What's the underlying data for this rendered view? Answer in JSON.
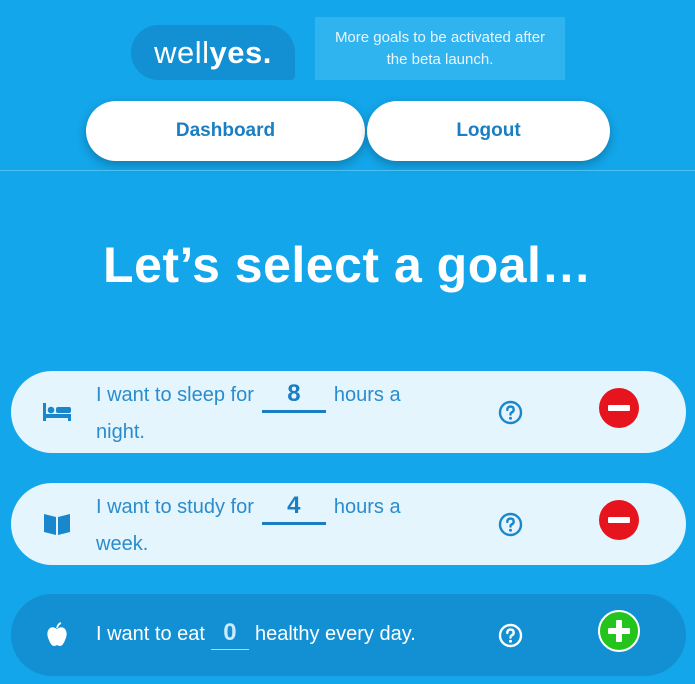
{
  "logo": {
    "light": "well",
    "bold": "yes."
  },
  "beta_note": "More goals to be activated after the beta launch.",
  "nav": {
    "dashboard_label": "Dashboard",
    "logout_label": "Logout"
  },
  "heading": "Let’s select a goal…",
  "goals": [
    {
      "icon": "bed-icon",
      "prefix": "I want to sleep for",
      "value": "8",
      "suffix": "hours a night.",
      "active": true,
      "action": "remove"
    },
    {
      "icon": "book-icon",
      "prefix": "I want to study for",
      "value": "4",
      "suffix": "hours a week.",
      "active": true,
      "action": "remove"
    },
    {
      "icon": "apple-icon",
      "prefix": "I want to eat",
      "value": "0",
      "suffix": "healthy every day.",
      "active": false,
      "action": "add"
    }
  ],
  "colors": {
    "background": "#13a6ea",
    "card": "#e4f5fd",
    "remove": "#e5141d",
    "add": "#25c41c",
    "accent": "#1a7fc2"
  }
}
